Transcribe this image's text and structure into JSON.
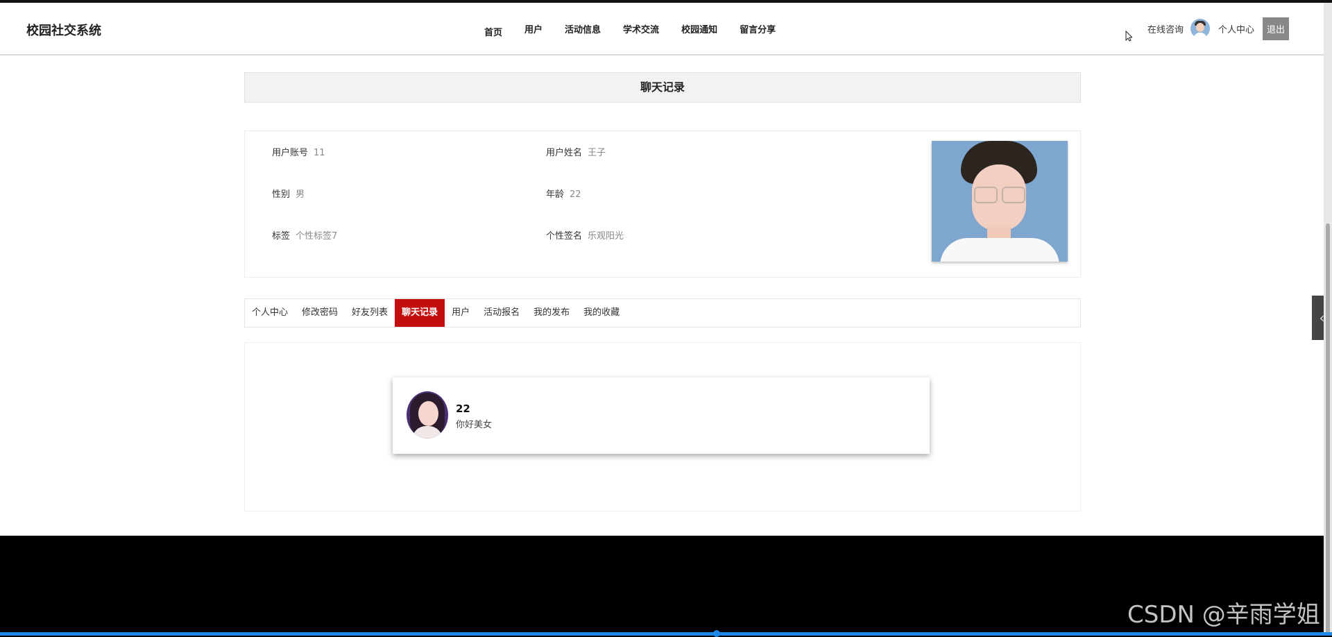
{
  "header": {
    "logo": "校园社交系统",
    "nav": [
      "首页",
      "用户",
      "活动信息",
      "学术交流",
      "校园通知",
      "留言分享"
    ],
    "consult": "在线咨询",
    "personal_center": "个人中心",
    "logout": "退出"
  },
  "page_title": "聊天记录",
  "profile": {
    "account_label": "用户账号",
    "account_value": "11",
    "name_label": "用户姓名",
    "name_value": "王子",
    "gender_label": "性别",
    "gender_value": "男",
    "age_label": "年龄",
    "age_value": "22",
    "tag_label": "标签",
    "tag_value": "个性标签7",
    "signature_label": "个性签名",
    "signature_value": "乐观阳光"
  },
  "tabs": [
    "个人中心",
    "修改密码",
    "好友列表",
    "聊天记录",
    "用户",
    "活动报名",
    "我的发布",
    "我的收藏"
  ],
  "active_tab": "聊天记录",
  "chat": {
    "name": "22",
    "message": "你好美女"
  },
  "watermark": "CSDN @辛雨学姐",
  "colors": {
    "accent_red": "#c40d0d",
    "progress_blue": "#1e88e5"
  }
}
